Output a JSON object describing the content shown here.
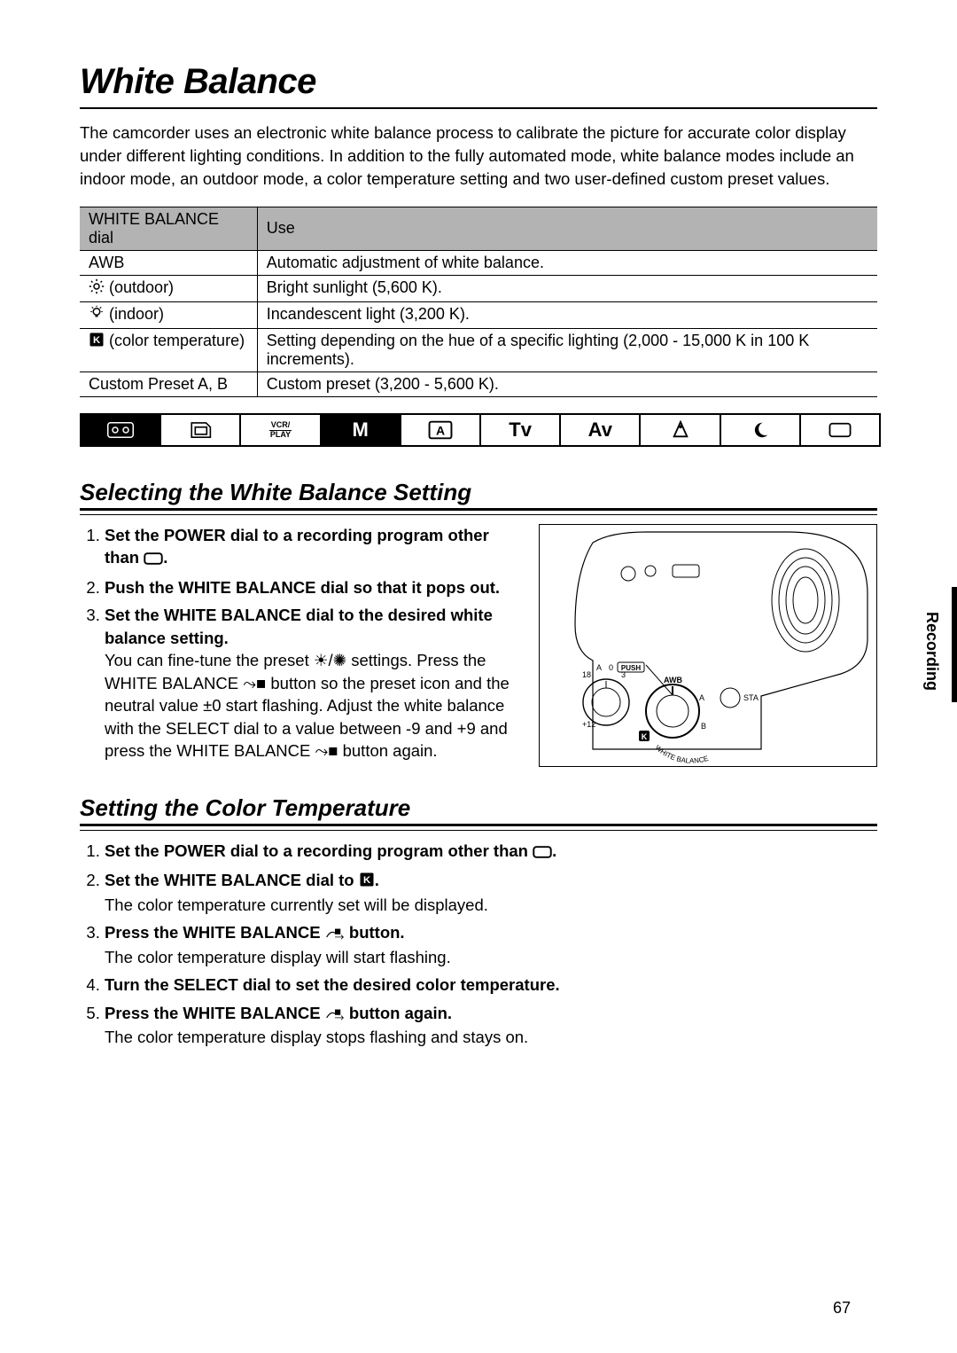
{
  "title": "White Balance",
  "intro": "The camcorder uses an electronic white balance process to calibrate the picture for accurate color display under different lighting conditions. In addition to the fully automated mode, white balance modes include an indoor mode, an outdoor mode, a color temperature setting and two user-defined custom preset values.",
  "table": {
    "headers": [
      "WHITE BALANCE dial",
      "Use"
    ],
    "rows": [
      {
        "dial": "AWB",
        "icon": "",
        "use": "Automatic adjustment of white balance."
      },
      {
        "dial": "(outdoor)",
        "icon": "sun",
        "use": "Bright sunlight (5,600 K)."
      },
      {
        "dial": "(indoor)",
        "icon": "bulb",
        "use": "Incandescent light (3,200 K)."
      },
      {
        "dial": "(color temperature)",
        "icon": "k",
        "use": "Setting depending on the hue of a specific lighting (2,000 - 15,000 K in 100 K increments)."
      },
      {
        "dial": "Custom Preset A, B",
        "icon": "",
        "use": "Custom preset (3,200 - 5,600 K)."
      }
    ]
  },
  "modebar": [
    "tape",
    "card",
    "VCR/\nPLAY",
    "M",
    "A",
    "Tv",
    "Av",
    "spot",
    "night",
    "easy"
  ],
  "section1": {
    "heading": "Selecting the White Balance Setting",
    "steps": [
      {
        "head": "Set the POWER dial to a recording program other than ",
        "tail_icon": "easy-rect",
        "tail": "."
      },
      {
        "head": "Push the WHITE BALANCE dial so that it pops out."
      },
      {
        "head": "Set the WHITE BALANCE dial to the desired white balance setting.",
        "note": "You can fine-tune the preset ☀/✺ settings. Press the WHITE BALANCE ⤳■ button so the preset icon and the neutral value ±0 start flashing. Adjust the white balance with the SELECT dial to a value between -9 and +9 and press the WHITE BALANCE ⤳■ button again."
      }
    ],
    "figure_labels": {
      "push": "PUSH",
      "awb": "AWB",
      "a": "A",
      "b": "B",
      "sta": "STA",
      "wb": "WHITE BALANCE",
      "n3": "3",
      "n0": "0",
      "np12": "+12",
      "n18": "18"
    }
  },
  "section2": {
    "heading": "Setting the Color Temperature",
    "steps": [
      {
        "head": "Set the POWER dial to a recording program other than ",
        "tail_icon": "easy-rect",
        "tail": "."
      },
      {
        "head": "Set the WHITE BALANCE dial to ",
        "tail_icon": "k-box",
        "tail": ".",
        "note": "The color temperature currently set will be displayed."
      },
      {
        "head": "Press the WHITE BALANCE ",
        "mid_icon": "set-btn",
        "tail": " button.",
        "note": "The color temperature display will start flashing."
      },
      {
        "head": "Turn the SELECT dial to set the desired color temperature."
      },
      {
        "head": "Press the WHITE BALANCE ",
        "mid_icon": "set-btn",
        "tail": " button again.",
        "note": "The color temperature display stops flashing and stays on."
      }
    ]
  },
  "side_label": "Recording",
  "page_number": "67"
}
